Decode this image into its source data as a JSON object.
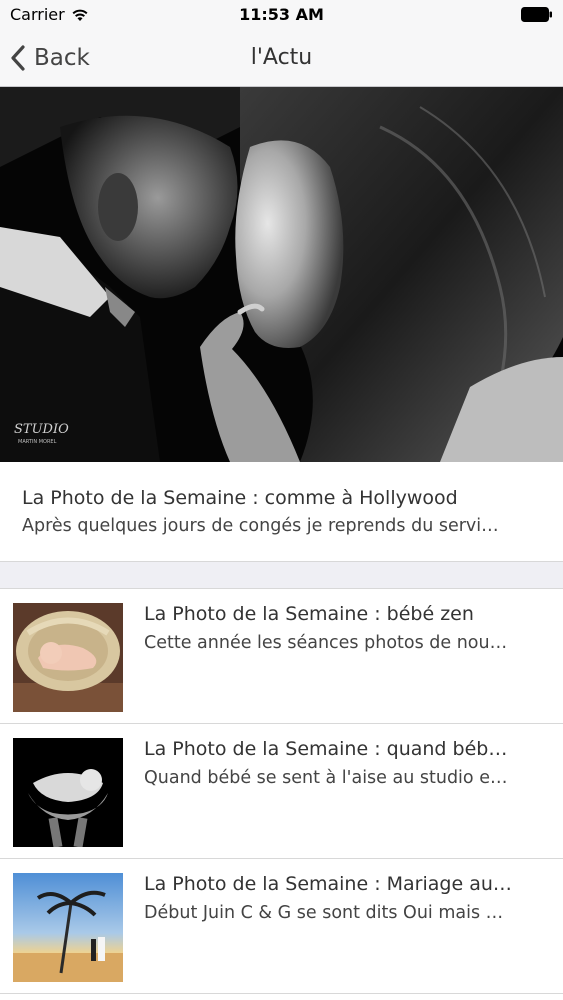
{
  "status_bar": {
    "carrier": "Carrier",
    "time": "11:53 AM"
  },
  "nav": {
    "back_label": "Back",
    "title": "l'Actu"
  },
  "hero": {
    "watermark_line1": "STUDIO",
    "watermark_line2": "MARTIN MOREL"
  },
  "featured": {
    "title": "La Photo de la Semaine : comme à Hollywood",
    "subtitle": "Après quelques jours de congés je reprends du servi…"
  },
  "articles": [
    {
      "title": "La Photo de la Semaine : bébé zen",
      "subtitle": "Cette année les séances photos de nou…"
    },
    {
      "title": "La Photo de la Semaine : quand béb…",
      "subtitle": "Quand bébé se sent à l'aise au studio e…"
    },
    {
      "title": "La Photo de la Semaine : Mariage au…",
      "subtitle": "Début Juin C & G se sont dits Oui mais …"
    }
  ]
}
